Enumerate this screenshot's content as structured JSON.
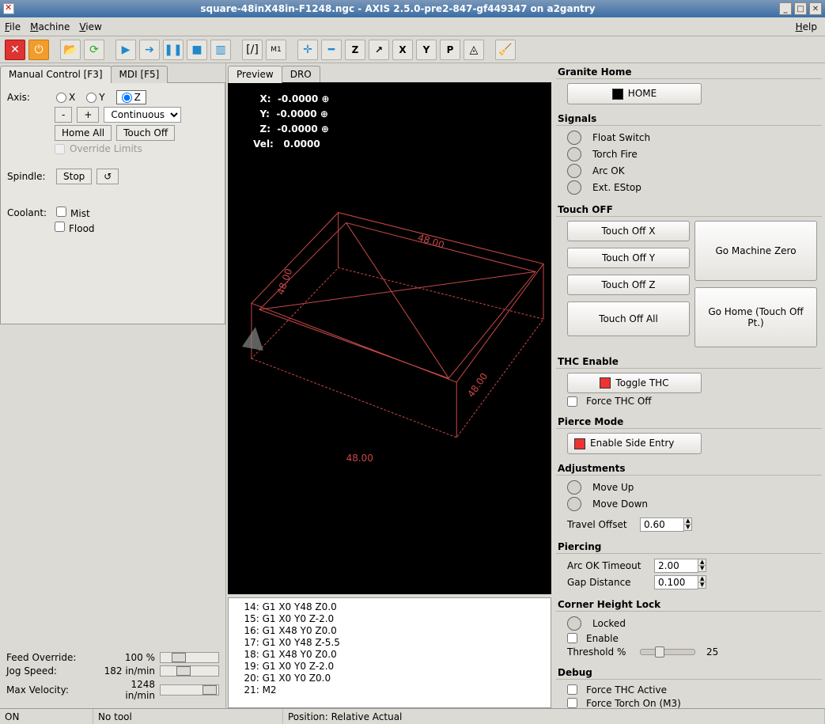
{
  "window": {
    "title": "square-48inX48in-F1248.ngc - AXIS 2.5.0-pre2-847-gf449347 on a2gantry"
  },
  "menu": {
    "file": "File",
    "machine": "Machine",
    "view": "View",
    "help": "Help"
  },
  "tabs_left": {
    "manual": "Manual Control [F3]",
    "mdi": "MDI [F5]"
  },
  "axis": {
    "label": "Axis:",
    "x": "X",
    "y": "Y",
    "z": "Z",
    "minus": "-",
    "plus": "+",
    "mode": "Continuous",
    "home_all": "Home All",
    "touch_off": "Touch Off",
    "override": "Override Limits"
  },
  "spindle": {
    "label": "Spindle:",
    "stop": "Stop"
  },
  "coolant": {
    "label": "Coolant:",
    "mist": "Mist",
    "flood": "Flood"
  },
  "sliders": {
    "feed_label": "Feed Override:",
    "feed_val": "100 %",
    "jog_label": "Jog Speed:",
    "jog_val": "182 in/min",
    "max_label": "Max Velocity:",
    "max_val": "1248 in/min"
  },
  "tabs_center": {
    "preview": "Preview",
    "dro": "DRO"
  },
  "dro": {
    "x_lbl": "X:",
    "x": "-0.0000",
    "y_lbl": "Y:",
    "y": "-0.0000",
    "z_lbl": "Z:",
    "z": "-0.0000",
    "vel_lbl": "Vel:",
    "vel": "0.0000",
    "dim": "48.00"
  },
  "code": [
    "   14: G1 X0 Y48 Z0.0",
    "   15: G1 X0 Y0 Z-2.0",
    "   16: G1 X48 Y0 Z0.0",
    "   17: G1 X0 Y48 Z-5.5",
    "   18: G1 X48 Y0 Z0.0",
    "   19: G1 X0 Y0 Z-2.0",
    "   20: G1 X0 Y0 Z0.0",
    "   21: M2"
  ],
  "status": {
    "on": "ON",
    "tool": "No tool",
    "pos": "Position: Relative Actual"
  },
  "right": {
    "granite": {
      "title": "Granite Home",
      "home": "HOME"
    },
    "signals": {
      "title": "Signals",
      "float": "Float Switch",
      "torch": "Torch Fire",
      "arc": "Arc OK",
      "estop": "Ext. EStop"
    },
    "touchoff": {
      "title": "Touch OFF",
      "x": "Touch Off X",
      "y": "Touch Off Y",
      "z": "Touch Off Z",
      "all": "Touch Off All",
      "mzero": "Go Machine Zero",
      "gohome": "Go Home (Touch Off Pt.)"
    },
    "thc": {
      "title": "THC Enable",
      "toggle": "Toggle THC",
      "force": "Force THC Off"
    },
    "pierce": {
      "title": "Pierce Mode",
      "side": "Enable Side Entry"
    },
    "adjust": {
      "title": "Adjustments",
      "up": "Move Up",
      "down": "Move Down",
      "offset_lbl": "Travel Offset",
      "offset": "0.60"
    },
    "piercing": {
      "title": "Piercing",
      "arc_lbl": "Arc OK Timeout",
      "arc": "2.00",
      "gap_lbl": "Gap Distance",
      "gap": "0.100"
    },
    "corner": {
      "title": "Corner Height Lock",
      "locked": "Locked",
      "enable": "Enable",
      "thresh_lbl": "Threshold %",
      "thresh": "25"
    },
    "debug": {
      "title": "Debug",
      "fthc": "Force THC Active",
      "ftorch": "Force Torch On (M3)"
    }
  }
}
